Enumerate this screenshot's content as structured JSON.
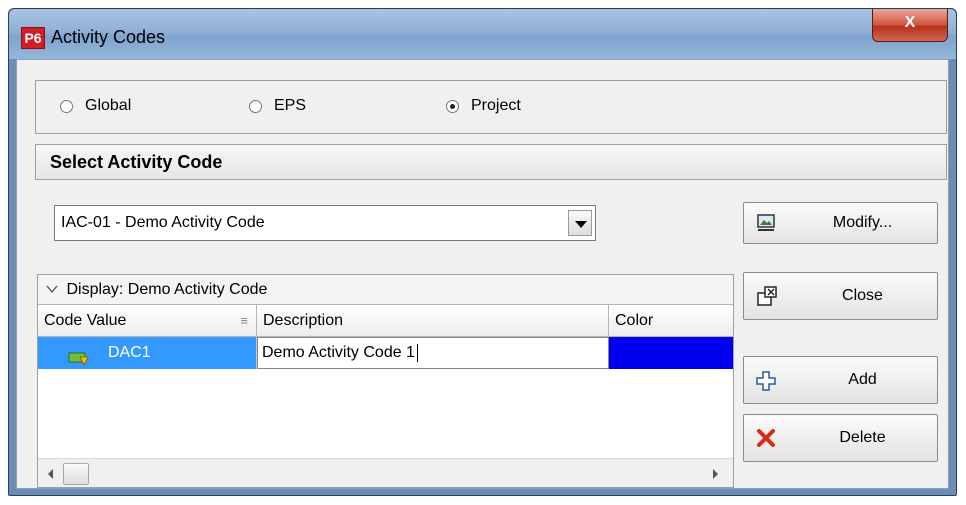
{
  "window": {
    "logo": "P6",
    "title": "Activity Codes",
    "close_glyph": "X"
  },
  "scope": {
    "options": [
      "Global",
      "EPS",
      "Project"
    ],
    "selected": "Project"
  },
  "section_header": "Select Activity Code",
  "code_select": {
    "value": "IAC-01 - Demo Activity Code"
  },
  "buttons": {
    "modify": "Modify...",
    "close": "Close",
    "add": "Add",
    "delete": "Delete"
  },
  "grid": {
    "caption": "Display: Demo Activity Code",
    "columns": [
      "Code Value",
      "Description",
      "Color"
    ],
    "rows": [
      {
        "code_value": "DAC1",
        "description": "Demo Activity Code 1",
        "color": "#0000ee",
        "selected": true
      }
    ]
  },
  "colors": {
    "selection": "#3399ff",
    "title_bar": "#8fb0d6",
    "delete_icon": "#d62c16"
  }
}
